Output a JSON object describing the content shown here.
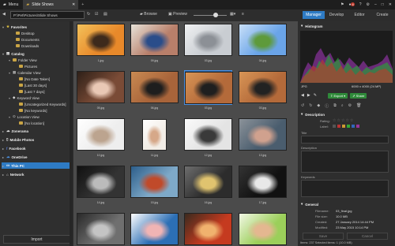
{
  "titlebar": {
    "menu_label": "Menu",
    "tab_label": "Slide Shows",
    "notif_count": "4"
  },
  "toolbar": {
    "path_value": "P:\\Pet\\Pictures\\Slide Shows",
    "browse_label": "Browse",
    "preview_label": "Preview"
  },
  "modes": [
    "Manager",
    "Develop",
    "Editor",
    "Create"
  ],
  "tree": {
    "favorites": "Favorites",
    "desktop": "Desktop",
    "documents": "Documents",
    "downloads": "Downloads",
    "catalog": "Catalog",
    "folder_view": "Folder View",
    "pictures": "Pictures",
    "calendar_view": "Calendar View",
    "no_date": "[No Date Taken]",
    "last30": "[Last 30 days]",
    "last7": "[Last 7 days]",
    "keyword_view": "Keyword View",
    "uncat_keywords": "[Uncategorized Keywords]",
    "no_keywords": "[No keywords]",
    "location_view": "Location View",
    "no_location": "[No location]",
    "zonerama": "Zonerama",
    "mobile": "Mobile Photos",
    "facebook": "Facebook",
    "onedrive": "OneDrive",
    "thispc": "This PC",
    "network": "Network"
  },
  "import_label": "Import",
  "thumbnails": [
    {
      "name": "1.jpg",
      "colors": [
        "#e8892a",
        "#3d2a1c",
        "#f3c15a"
      ]
    },
    {
      "name": "09.jpg",
      "colors": [
        "#b87f6a",
        "#2a4d8a",
        "#e7e2d8"
      ]
    },
    {
      "name": "03.jpg",
      "colors": [
        "#c9cdd2",
        "#8c9096",
        "#f0f1f2"
      ]
    },
    {
      "name": "04.jpg",
      "colors": [
        "#6aa4e8",
        "#5e9a3b",
        "#c8dff8"
      ]
    },
    {
      "name": "05.jpg",
      "colors": [
        "#7a4b36",
        "#e9c8b5",
        "#2e2018"
      ]
    },
    {
      "name": "06.jpg",
      "colors": [
        "#a8643a",
        "#1e1e1e",
        "#c98a52"
      ]
    },
    {
      "name": "03.jpg",
      "colors": [
        "#b46a3a",
        "#1f1f1f",
        "#d89556"
      ]
    },
    {
      "name": "03.jpg",
      "colors": [
        "#b46a3a",
        "#222222",
        "#d89556"
      ]
    },
    {
      "name": "10.jpg",
      "colors": [
        "#eeeeee",
        "#bca48f",
        "#ffffff"
      ]
    },
    {
      "name": "11.jpg",
      "colors": [
        "#f2ede6",
        "#d6a889",
        "#ffffff"
      ]
    },
    {
      "name": "12.jpg",
      "colors": [
        "#e4e4e4",
        "#3a3a3a",
        "#fafafa"
      ]
    },
    {
      "name": "13.jpg",
      "colors": [
        "#4a5d6e",
        "#d0a18e",
        "#8b9299"
      ]
    },
    {
      "name": "14.jpg",
      "colors": [
        "#333333",
        "#bbbbbb",
        "#111111"
      ]
    },
    {
      "name": "15.jpg",
      "colors": [
        "#7ea9c8",
        "#c04a2a",
        "#2d5e8a"
      ]
    },
    {
      "name": "16.jpg",
      "colors": [
        "#2c2c2c",
        "#e0c36f",
        "#6e6e6e"
      ]
    },
    {
      "name": "17.jpg",
      "colors": [
        "#111111",
        "#e8e8e8",
        "#333333"
      ]
    },
    {
      "name": "18.jpg",
      "colors": [
        "#6f6f6f",
        "#c4c4c4",
        "#2a2a2a"
      ]
    },
    {
      "name": "19.jpg",
      "colors": [
        "#2c6fb5",
        "#f0b4b4",
        "#ffffff"
      ]
    },
    {
      "name": "20.jpg",
      "colors": [
        "#c53a1f",
        "#f0b26e",
        "#3a2a1e"
      ]
    },
    {
      "name": "21.jpg",
      "colors": [
        "#9bcf5a",
        "#e4b790",
        "#f2f7e5"
      ]
    }
  ],
  "panel": {
    "histogram_title": "Histogram",
    "file_type": "JPG",
    "dimensions": "6000 x 4000 (24 MP)",
    "export_label": "Export",
    "share_label": "Share",
    "description_title": "Description",
    "rating_label": "Rating:",
    "label_label": "Label:",
    "title_label": "Title",
    "description_label": "Description",
    "keywords_label": "Keywords",
    "general_title": "General",
    "filename_label": "Filename:",
    "filename_value": "03_final.jpg",
    "filesize_label": "File size:",
    "filesize_value": "10.0 MB",
    "created_label": "Created:",
    "created_value": "27 January 2014 14:44 PM",
    "modified_label": "Modified:",
    "modified_value": "23 May 2015 10:14 PM",
    "save_label": "Save",
    "cancel_label": "Cancel"
  },
  "status": {
    "text": "Items: 237    Selected items: 1 (10.0 MB)"
  },
  "colors": {
    "accent": "#2e7bc4",
    "export_green": "#2f8a3a",
    "folder": "#c9a445",
    "notif_red": "#c0392b"
  }
}
